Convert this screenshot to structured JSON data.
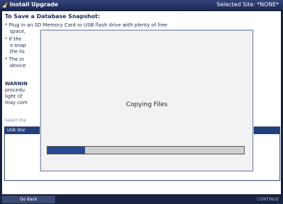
{
  "window": {
    "title": "Install Upgrade",
    "selected_site": "Selected Site: *NONE*"
  },
  "content": {
    "heading": "To Save a Database Snapshot:",
    "bullet1": "* Plug in an SD Memory Card or USB flash drive with plenty of free",
    "bullet1_cont": "space,",
    "bullet2": "* If the",
    "bullet2_cont1": "a snap",
    "bullet2_cont2": "the lis",
    "bullet3": "* The in",
    "bullet3_cont": "device",
    "warn1": "WARNIN",
    "warn2": "procedu",
    "warn3": "light (if",
    "warn4": "may com",
    "select_label": "Select the",
    "drive_item": "USB Stor"
  },
  "modal": {
    "message": "Copying Files",
    "progress": 0.19
  },
  "footer": {
    "back_label": "Go Back",
    "continue_label": "CONTINUE"
  },
  "colors": {
    "titlebar": "#1d2a55",
    "progress_fill": "#2a4a90",
    "selection": "#22407a"
  }
}
